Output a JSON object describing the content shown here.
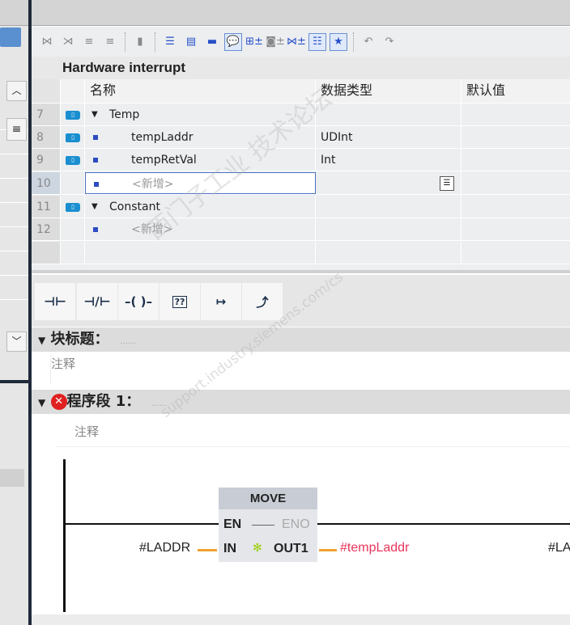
{
  "section_title": "Hardware interrupt",
  "table": {
    "headers": {
      "name": "名称",
      "datatype": "数据类型",
      "default": "默认值"
    },
    "rows": [
      {
        "num": "7",
        "name": "Temp",
        "datatype": "",
        "type": "section"
      },
      {
        "num": "8",
        "name": "tempLaddr",
        "datatype": "UDInt",
        "type": "var"
      },
      {
        "num": "9",
        "name": "tempRetVal",
        "datatype": "Int",
        "type": "var"
      },
      {
        "num": "10",
        "name": "<新增>",
        "datatype": "",
        "type": "new"
      },
      {
        "num": "11",
        "name": "Constant",
        "datatype": "",
        "type": "section"
      },
      {
        "num": "12",
        "name": "<新增>",
        "datatype": "",
        "type": "new"
      }
    ]
  },
  "palette": {
    "no_contact": "⊣⊢",
    "nc_contact": "⊣/⊢",
    "coil": "–( )–",
    "empty_box": "??",
    "open_branch": "↦",
    "close_branch": "⤴"
  },
  "block_title": {
    "label": "块标题：",
    "placeholder": "......",
    "comment": "注释"
  },
  "network": {
    "label": "程序段 1：",
    "placeholder": "......",
    "comment": "注释"
  },
  "move_box": {
    "title": "MOVE",
    "en": "EN",
    "eno": "ENO",
    "in": "IN",
    "out": "OUT1",
    "in_operand": "#LADDR",
    "out_operand": "#tempLaddr",
    "right_operand": "#LA"
  },
  "watermark": {
    "text1": "西门子工业  技术论坛",
    "text2": "support.industry.siemens.com/cs"
  },
  "colors": {
    "error": "#e02020",
    "operand_error": "#e8345a",
    "wire": "#f0a030"
  }
}
